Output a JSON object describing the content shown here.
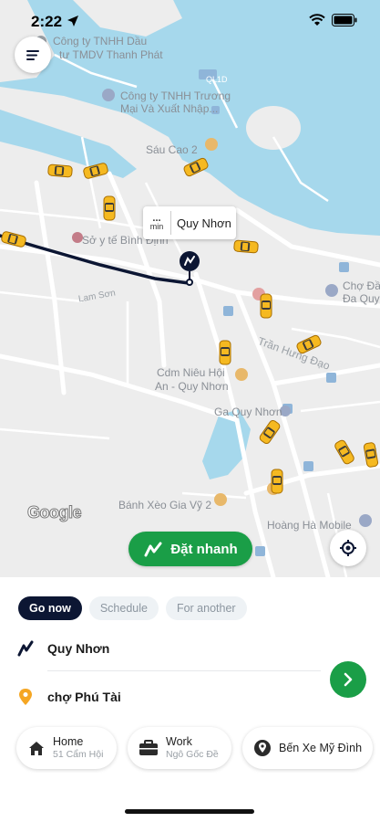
{
  "status_bar": {
    "time": "2:22"
  },
  "map": {
    "pois": [
      "Công ty TNHH Dầu",
      "tư TMDV Thanh Phát",
      "Công ty TNHH Trương",
      "Mại Và Xuất Nhập...",
      "Sáu Cao 2",
      "Sở y tế Bình Định",
      "Chợ Đầm",
      "Đa Quy",
      "Trần Hưng Đạo",
      "Cdm Niêu Hội",
      "An - Quy Nhơn",
      "Ga Quy Nhơn",
      "Bánh Xèo Gia Vỹ 2",
      "Hoàng Hà Mobile",
      "Lam Sơn",
      "Trường Đại học Quy Nhơn"
    ],
    "road_shields": [
      "QL1D"
    ],
    "pickup": {
      "eta_top": "...",
      "eta_unit": "min",
      "label": "Quy Nhơn"
    },
    "attribution": "Google",
    "quick_book_label": "Đặt nhanh"
  },
  "sheet": {
    "tabs": [
      {
        "label": "Go now",
        "active": true
      },
      {
        "label": "Schedule",
        "active": false
      },
      {
        "label": "For another",
        "active": false
      }
    ],
    "pickup_text": "Quy Nhơn",
    "destination_text": "chợ Phú Tài",
    "shortcuts": [
      {
        "title": "Home",
        "subtitle": "51 Cẩm Hội",
        "icon": "home-icon"
      },
      {
        "title": "Work",
        "subtitle": "Ngô Gốc Đề",
        "icon": "briefcase-icon"
      },
      {
        "title": "Bến Xe Mỹ Đình",
        "subtitle": "",
        "icon": "pin-icon"
      }
    ]
  },
  "colors": {
    "brand_green": "#1a9e47",
    "navy": "#0c1633",
    "water": "#a6d8ec",
    "taxi_yellow": "#f5b921"
  }
}
